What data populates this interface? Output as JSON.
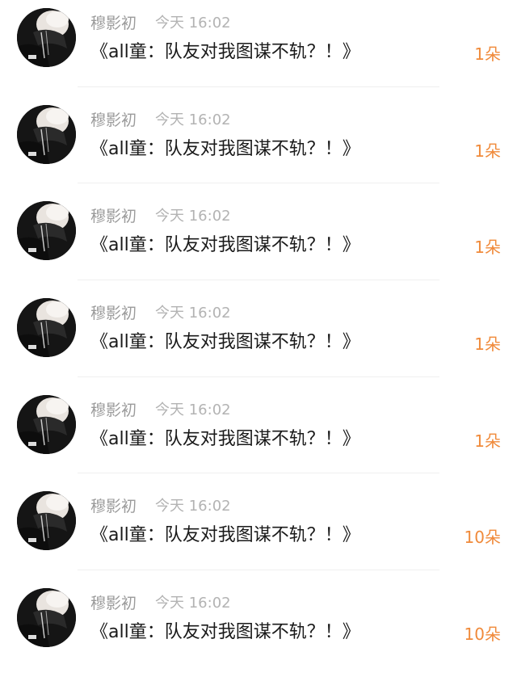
{
  "colors": {
    "username": "#9b9b9b",
    "time": "#b3b3b3",
    "title": "#1a1a1a",
    "count": "#f08a3a",
    "divider": "#efefef"
  },
  "items": [
    {
      "username": "穆影初",
      "time": "今天 16:02",
      "title": "《all童：队友对我图谋不轨？！》",
      "count": "1朵",
      "avatar_icon": "avatar-image"
    },
    {
      "username": "穆影初",
      "time": "今天 16:02",
      "title": "《all童：队友对我图谋不轨？！》",
      "count": "1朵",
      "avatar_icon": "avatar-image"
    },
    {
      "username": "穆影初",
      "time": "今天 16:02",
      "title": "《all童：队友对我图谋不轨？！》",
      "count": "1朵",
      "avatar_icon": "avatar-image"
    },
    {
      "username": "穆影初",
      "time": "今天 16:02",
      "title": "《all童：队友对我图谋不轨？！》",
      "count": "1朵",
      "avatar_icon": "avatar-image"
    },
    {
      "username": "穆影初",
      "time": "今天 16:02",
      "title": "《all童：队友对我图谋不轨？！》",
      "count": "1朵",
      "avatar_icon": "avatar-image"
    },
    {
      "username": "穆影初",
      "time": "今天 16:02",
      "title": "《all童：队友对我图谋不轨？！》",
      "count": "10朵",
      "avatar_icon": "avatar-image"
    },
    {
      "username": "穆影初",
      "time": "今天 16:02",
      "title": "《all童：队友对我图谋不轨？！》",
      "count": "10朵",
      "avatar_icon": "avatar-image"
    }
  ]
}
